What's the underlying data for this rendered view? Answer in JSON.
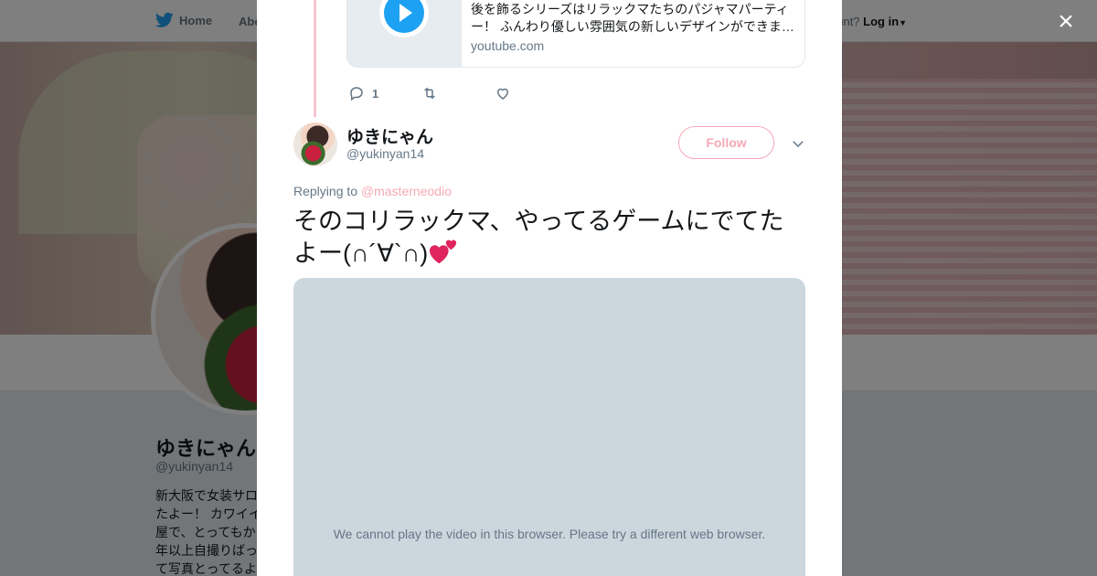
{
  "nav": {
    "home_label": "Home",
    "about_label": "Abo",
    "account_prompt": "ccount?",
    "login_label": "Log in"
  },
  "profile": {
    "name": "ゆきにゃん",
    "handle": "@yukinyan14",
    "bio": "新大阪で女装サロ\nたよー！ カワイイ\n屋で、とってもか\n年以上自撮りばっ\nて写真とってるよ"
  },
  "modal": {
    "close_icon": "×",
    "card": {
      "description_line1": "後を飾るシリーズはリラックマたちのパジャマパーティ",
      "description_line2": "ー！ ふんわり優しい雰囲気の新しいデザインができま…",
      "domain": "youtube.com"
    },
    "actions": {
      "reply_count": "1",
      "retweet_count": "",
      "like_count": ""
    },
    "tweet": {
      "name": "ゆきにゃん",
      "handle": "@yukinyan14",
      "follow_label": "Follow",
      "replying_prefix": "Replying to ",
      "replying_to": "@masterneodio",
      "text": "そのコリラックマ、やってるゲームにでてたよー(∩´∀`∩)",
      "emoji": "two-hearts"
    },
    "video_message": "We cannot play the video in this browser. Please try a different web browser."
  },
  "colors": {
    "accent": "#f5a9b8",
    "twitter_blue": "#1da1f2",
    "text_secondary": "#657786"
  }
}
